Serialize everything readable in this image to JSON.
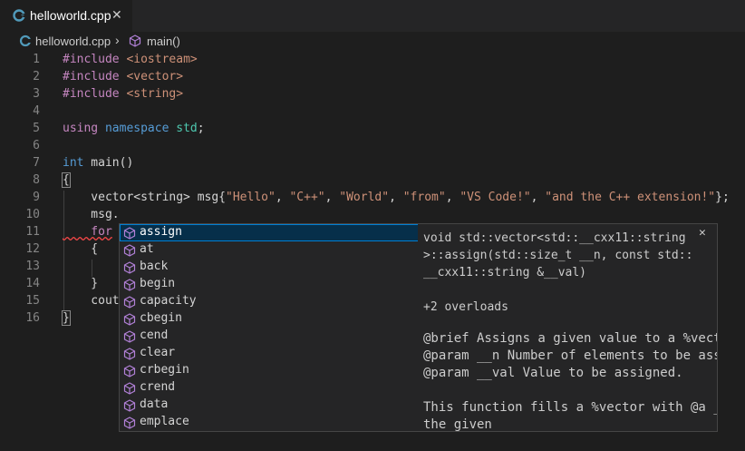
{
  "tab": {
    "title": "helloworld.cpp",
    "close": "✕",
    "icon": "cpp-file-icon"
  },
  "breadcrumb": {
    "file": "helloworld.cpp",
    "separator": "›",
    "symbol": "main()"
  },
  "line_numbers": [
    "1",
    "2",
    "3",
    "4",
    "5",
    "6",
    "7",
    "8",
    "9",
    "10",
    "11",
    "12",
    "13",
    "14",
    "15",
    "16"
  ],
  "code": {
    "l1": {
      "a": "#include",
      "b": " <iostream>"
    },
    "l2": {
      "a": "#include",
      "b": " <vector>"
    },
    "l3": {
      "a": "#include",
      "b": " <string>"
    },
    "l5": {
      "a": "using",
      "b": " ",
      "c": "namespace",
      "d": " ",
      "e": "std",
      "f": ";"
    },
    "l7": {
      "a": "int",
      "b": " main()"
    },
    "l8": "{",
    "l9": {
      "a": "    vector<string> msg{",
      "s1": "\"Hello\"",
      "c1": ", ",
      "s2": "\"C++\"",
      "c2": ", ",
      "s3": "\"World\"",
      "c3": ", ",
      "s4": "\"from\"",
      "c4": ", ",
      "s5": "\"VS Code!\"",
      "c5": ", ",
      "s6": "\"and the C++ extension!\"",
      "end": "};"
    },
    "l10": "    msg.",
    "l11": "    for",
    "l12": "    {",
    "l14": "    }",
    "l15": "    cout",
    "l16": "}"
  },
  "suggestions": [
    "assign",
    "at",
    "back",
    "begin",
    "capacity",
    "cbegin",
    "cend",
    "clear",
    "crbegin",
    "crend",
    "data",
    "emplace"
  ],
  "details": {
    "signature": "void std::vector<std::__cxx11::string\n>::assign(std::size_t __n, const std::\n__cxx11::string &__val)",
    "overloads": "+2 overloads",
    "brief": "@brief Assigns a given value to a %vector.",
    "param1": "@param __n Number of elements to be assigned.",
    "param2": "@param __val Value to be assigned.",
    "desc1": "This function fills a %vector with @a __n copies of",
    "desc2": "the given",
    "close": "✕"
  },
  "colors": {
    "keyword": "#569cd6",
    "include": "#c586c0",
    "string": "#ce9178",
    "type": "#4ec9b0",
    "selection": "#062f4a",
    "method_icon": "#b180d7"
  }
}
